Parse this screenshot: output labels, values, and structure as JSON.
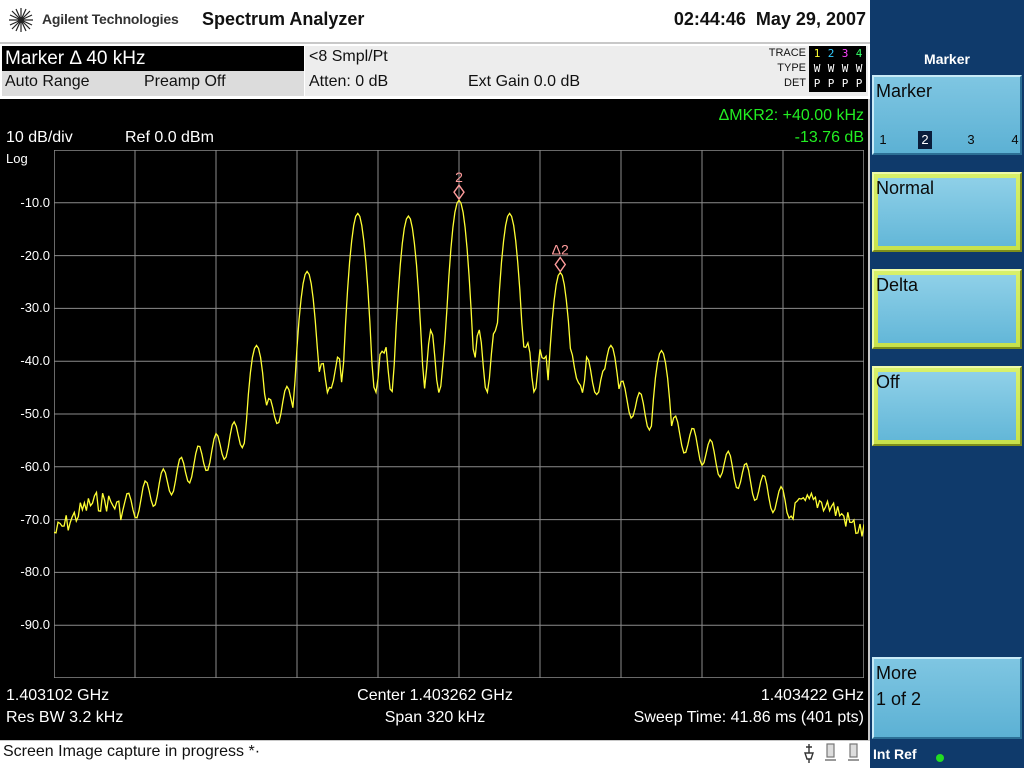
{
  "header": {
    "brand": "Agilent Technologies",
    "title": "Spectrum Analyzer",
    "time": "02:44:46",
    "date": "May 29, 2007"
  },
  "settings": {
    "marker": "Marker Δ 40 kHz",
    "auto_range": "Auto Range",
    "preamp": "Preamp Off",
    "samples": "<8 Smpl/Pt",
    "atten": "Atten: 0 dB",
    "ext_gain": "Ext Gain 0.0 dB",
    "trace_label": "TRACE",
    "type_label": "TYPE",
    "det_label": "DET",
    "trace_numbers": [
      "1",
      "2",
      "3",
      "4"
    ],
    "trace_types": [
      "W",
      "W",
      "W",
      "W"
    ],
    "trace_dets": [
      "P",
      "P",
      "P",
      "P"
    ],
    "trace_colors": [
      "#ffff33",
      "#33ccff",
      "#ff44ff",
      "#33ff66"
    ]
  },
  "display": {
    "scale": "10 dB/div",
    "ref_level": "Ref 0.0 dBm",
    "log_label": "Log",
    "marker_readout_freq": "ΔMKR2: +40.00 kHz",
    "marker_readout_amp": "-13.76 dB",
    "y_labels": [
      "-10.0",
      "-20.0",
      "-30.0",
      "-40.0",
      "-50.0",
      "-60.0",
      "-70.0",
      "-80.0",
      "-90.0"
    ],
    "start_freq": "1.403102 GHz",
    "center_freq": "Center 1.403262 GHz",
    "stop_freq": "1.403422 GHz",
    "res_bw": "Res BW 3.2 kHz",
    "span": "Span 320 kHz",
    "sweep": "Sweep Time: 41.86 ms (401 pts)",
    "marker_ref_label": "2",
    "marker_delta_label": "Δ2"
  },
  "status": {
    "message": "Screen Image capture in progress  *·"
  },
  "softkeys": {
    "panel_title": "Marker",
    "marker_label": "Marker",
    "marker_numbers": [
      "1",
      "2",
      "3",
      "4"
    ],
    "marker_selected": "2",
    "normal": "Normal",
    "delta": "Delta",
    "off": "Off",
    "more": "More",
    "more_page": "1 of 2",
    "int_ref": "Int Ref"
  },
  "chart_data": {
    "type": "line",
    "x_start_ghz": 1.403102,
    "x_stop_ghz": 1.403422,
    "y_ref_dbm": 0,
    "y_div_db": 10,
    "ylim": [
      -100,
      0
    ],
    "points": 401,
    "trace_color": "#ffff33",
    "grid": true,
    "peaks": [
      {
        "freq_ghz": 1.403262,
        "level_dbm": -9.5
      },
      {
        "freq_ghz": 1.403302,
        "level_dbm": -23.2
      },
      {
        "freq_ghz": 1.403222,
        "level_dbm": -12.0
      },
      {
        "freq_ghz": 1.403242,
        "level_dbm": -12.5
      },
      {
        "freq_ghz": 1.403282,
        "level_dbm": -12.0
      },
      {
        "freq_ghz": 1.403322,
        "level_dbm": -37.0
      },
      {
        "freq_ghz": 1.403202,
        "level_dbm": -23.0
      },
      {
        "freq_ghz": 1.403182,
        "level_dbm": -37.0
      },
      {
        "freq_ghz": 1.403342,
        "level_dbm": -38.0
      }
    ],
    "markers": [
      {
        "label": "2",
        "freq_ghz": 1.403262,
        "level_dbm": -9.5
      },
      {
        "label": "Δ2",
        "freq_ghz": 1.403302,
        "level_dbm": -23.2
      }
    ]
  }
}
